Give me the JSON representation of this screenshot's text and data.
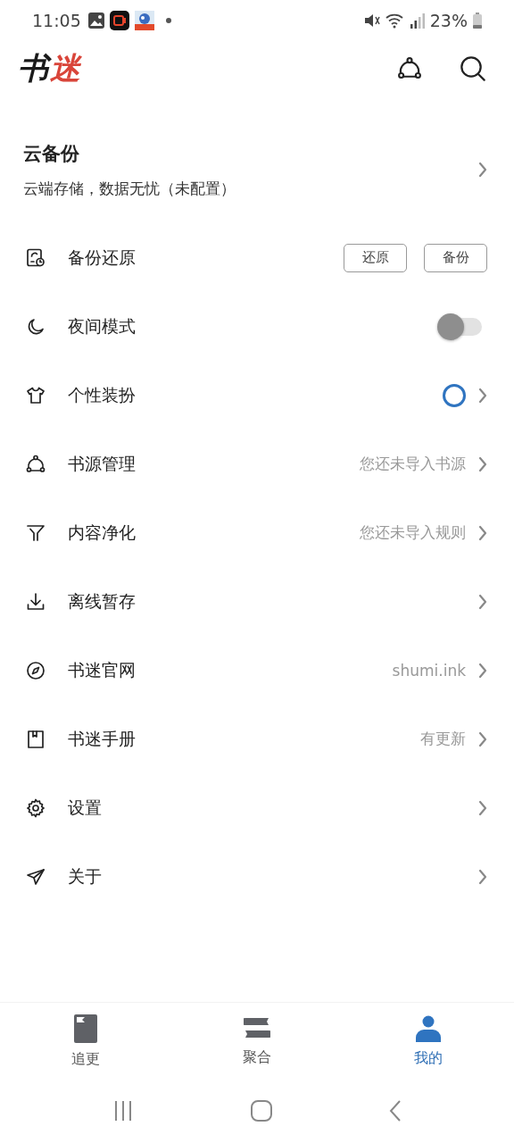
{
  "status_bar": {
    "time": "11:05",
    "battery": "23%"
  },
  "header": {
    "logo": [
      {
        "text": "书",
        "color": "#1a1a1a"
      },
      {
        "text": "迷",
        "color": "#d9453a"
      }
    ]
  },
  "cloud_backup": {
    "title": "云备份",
    "subtitle": "云端存储，数据无忧（未配置）"
  },
  "menu": [
    {
      "kind": "buttons",
      "label": "备份还原",
      "buttons": [
        "还原",
        "备份"
      ]
    },
    {
      "kind": "toggle",
      "label": "夜间模式",
      "on": false
    },
    {
      "kind": "color",
      "label": "个性装扮",
      "color": "#2f74c0"
    },
    {
      "kind": "detail",
      "label": "书源管理",
      "detail": "您还未导入书源"
    },
    {
      "kind": "detail",
      "label": "内容净化",
      "detail": "您还未导入规则"
    },
    {
      "kind": "detail",
      "label": "离线暂存"
    },
    {
      "kind": "detail",
      "label": "书迷官网",
      "detail": "shumi.ink"
    },
    {
      "kind": "detail",
      "label": "书迷手册",
      "detail": "有更新"
    },
    {
      "kind": "detail",
      "label": "设置"
    },
    {
      "kind": "detail",
      "label": "关于"
    }
  ],
  "tabs": [
    {
      "label": "追更",
      "selected": false
    },
    {
      "label": "聚合",
      "selected": false
    },
    {
      "label": "我的",
      "selected": true
    }
  ]
}
